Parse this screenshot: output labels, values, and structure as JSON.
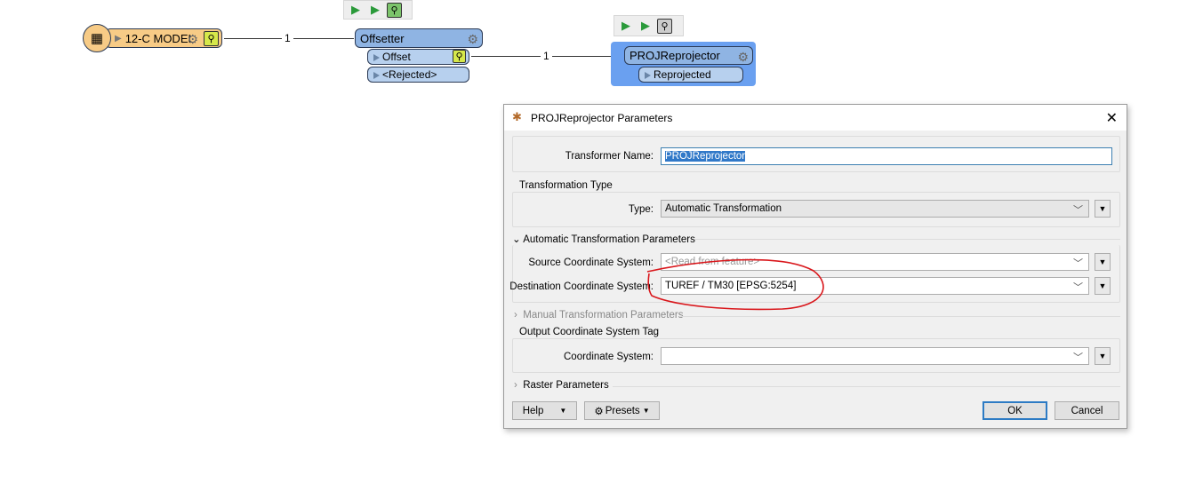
{
  "canvas": {
    "reader": {
      "label": "12-C MODEL",
      "icon": "table-reader-icon",
      "color": "#f7cb86"
    },
    "link1_count": "1",
    "link2_count": "1",
    "offsetter": {
      "label": "Offsetter",
      "ports": [
        "Offset",
        "<Rejected>"
      ],
      "color": "#8fb4e3"
    },
    "reprojector": {
      "label": "PROJReprojector",
      "ports": [
        "Reprojected"
      ],
      "selected_color": "#6aa0f0"
    }
  },
  "dialog": {
    "title": "PROJReprojector Parameters",
    "transformer_name_label": "Transformer Name:",
    "transformer_name_value": "PROJReprojector",
    "transformation_type_group": "Transformation Type",
    "type_label": "Type:",
    "type_value": "Automatic Transformation",
    "auto_section": "Automatic Transformation Parameters",
    "source_label": "Source Coordinate System:",
    "source_placeholder": "<Read from feature>",
    "dest_label": "Destination Coordinate System:",
    "dest_value": "TUREF / TM30 [EPSG:5254]",
    "manual_section": "Manual Transformation Parameters",
    "output_group": "Output Coordinate System Tag",
    "coord_label": "Coordinate System:",
    "coord_value": "",
    "raster_section": "Raster Parameters",
    "help": "Help",
    "presets": "Presets",
    "ok": "OK",
    "cancel": "Cancel",
    "annotation_color": "#d9161b"
  }
}
